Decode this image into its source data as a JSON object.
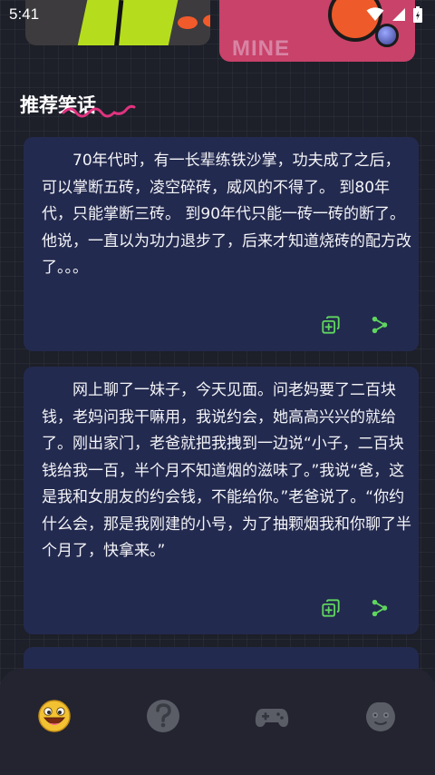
{
  "status_bar": {
    "time": "5:41"
  },
  "banner": {
    "right_word": "MINE"
  },
  "section": {
    "title": "推荐笑话"
  },
  "jokes": [
    {
      "text": "70年代时，有一长辈练铁沙掌，功夫成了之后，可以掌断五砖，凌空碎砖，威风的不得了。 到80年代，只能掌断三砖。 到90年代只能一砖一砖的断了。 他说，一直以为功力退步了，后来才知道烧砖的配方改了。。。"
    },
    {
      "text": "网上聊了一妹子，今天见面。问老妈要了二百块钱，老妈问我干嘛用，我说约会，她高高兴兴的就给了。刚出家门，老爸就把我拽到一边说“小子，二百块钱给我一百，半个月不知道烟的滋味了。”我说“爸，这是我和女朋友的约会钱，不能给你。”老爸说了。“你约什么会，那是我刚建的小号，为了抽颗烟我和你聊了半个月了，快拿来。”"
    }
  ],
  "bottom_nav": {
    "items": [
      {
        "name": "joke-tab-icon",
        "active": true
      },
      {
        "name": "riddle-tab-icon",
        "active": false
      },
      {
        "name": "game-tab-icon",
        "active": false
      },
      {
        "name": "profile-tab-icon",
        "active": false
      }
    ]
  },
  "colors": {
    "background": "#1d1f29",
    "card": "#232a4f",
    "accent_green": "#5fd65f",
    "squiggle_pink": "#e0337f",
    "nav_inactive": "#5a5c66",
    "nav_active": "#f2c232"
  }
}
